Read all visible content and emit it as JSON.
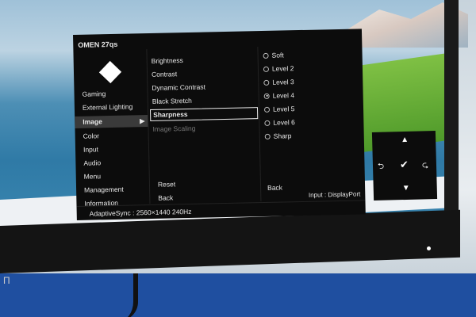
{
  "osd": {
    "title": "OMEN 27qs",
    "main_menu": [
      {
        "label": "Gaming"
      },
      {
        "label": "External Lighting"
      },
      {
        "label": "Image",
        "selected": true
      },
      {
        "label": "Color"
      },
      {
        "label": "Input"
      },
      {
        "label": "Audio"
      },
      {
        "label": "Menu"
      },
      {
        "label": "Management"
      },
      {
        "label": "Information"
      }
    ],
    "image_menu": [
      {
        "label": "Brightness"
      },
      {
        "label": "Contrast"
      },
      {
        "label": "Dynamic Contrast"
      },
      {
        "label": "Black Stretch"
      },
      {
        "label": "Sharpness",
        "selected": true
      },
      {
        "label": "Image Scaling",
        "disabled": true
      }
    ],
    "image_reset": "Reset",
    "image_back": "Back",
    "sharpness_options": [
      {
        "label": "Soft"
      },
      {
        "label": "Level 2"
      },
      {
        "label": "Level 3"
      },
      {
        "label": "Level 4",
        "checked": true
      },
      {
        "label": "Level 5"
      },
      {
        "label": "Level 6"
      },
      {
        "label": "Sharp"
      }
    ],
    "options_back": "Back",
    "status_left": "AdaptiveSync : 2560×1440  240Hz",
    "status_right": "Input : DisplayPort"
  },
  "nav_pad": {
    "up": "▲",
    "down": "▼",
    "left": "⮌",
    "right": "⮎",
    "ok": "✔"
  },
  "bezel_logo": "П",
  "colors": {
    "osd_bg": "#0c0c0c",
    "selected_bg": "#3a3a3a",
    "text": "#e8e8e8",
    "stand": "#1f4fa0"
  }
}
